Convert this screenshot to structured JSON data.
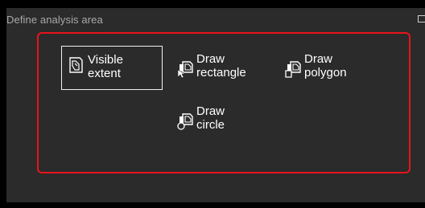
{
  "panel": {
    "title": "Define analysis area"
  },
  "tools": [
    {
      "id": "visible",
      "label_line1": "Visible",
      "label_line2": "extent",
      "icon": "visible-extent-icon",
      "selected": true
    },
    {
      "id": "rect",
      "label_line1": "Draw",
      "label_line2": "rectangle",
      "icon": "draw-rectangle-icon",
      "selected": false
    },
    {
      "id": "poly",
      "label_line1": "Draw",
      "label_line2": "polygon",
      "icon": "draw-polygon-icon",
      "selected": false
    },
    {
      "id": "circle",
      "label_line1": "Draw",
      "label_line2": "circle",
      "icon": "draw-circle-icon",
      "selected": false
    }
  ],
  "colors": {
    "background": "#000000",
    "panel": "#2b2b2b",
    "title_text": "#a9a9a9",
    "tool_text": "#ffffff",
    "highlight": "#e8141b"
  }
}
